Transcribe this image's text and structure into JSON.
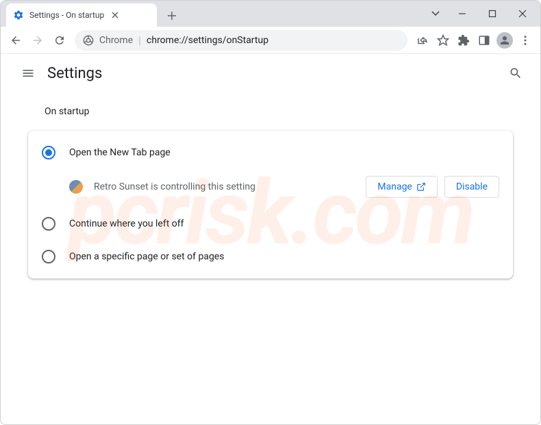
{
  "window": {
    "tab_title": "Settings - On startup"
  },
  "address": {
    "label": "Chrome",
    "url": "chrome://settings/onStartup"
  },
  "header": {
    "title": "Settings"
  },
  "section": {
    "title": "On startup"
  },
  "options": {
    "opt1": "Open the New Tab page",
    "opt2": "Continue where you left off",
    "opt3": "Open a specific page or set of pages"
  },
  "extension": {
    "notice": "Retro Sunset is controlling this setting",
    "manage": "Manage",
    "disable": "Disable"
  },
  "watermark": "pcrisk.com"
}
